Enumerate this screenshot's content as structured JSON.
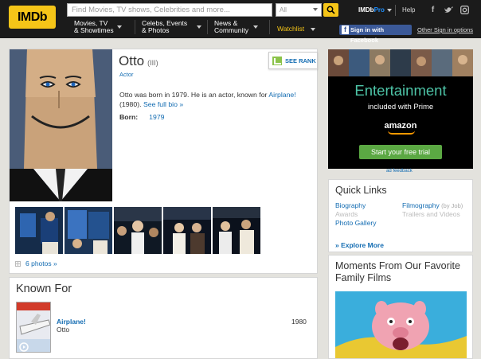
{
  "nav": {
    "logo": "IMDb",
    "search_placeholder": "Find Movies, TV shows, Celebrities and more...",
    "search_category": "All",
    "imdbpro": "IMDbPro",
    "help": "Help",
    "menu": [
      {
        "line1": "Movies, TV",
        "line2": "& Showtimes"
      },
      {
        "line1": "Celebs, Events",
        "line2": "& Photos"
      },
      {
        "line1": "News &",
        "line2": "Community"
      }
    ],
    "watchlist": "Watchlist",
    "facebook_signin": "Sign in with Facebook",
    "other_signin": "Other Sign in options",
    "social": [
      "f",
      "t",
      "o"
    ]
  },
  "profile": {
    "name": "Otto",
    "roman": "(III)",
    "role": "Actor",
    "see_rank": "SEE RANK",
    "bio_text": "Otto was born in 1979. He is an actor, known for ",
    "bio_movie": "Airplane!",
    "bio_year": " (1980). ",
    "bio_link": "See full bio »",
    "born_label": "Born:",
    "born_year": "1979",
    "photos_link": "6 photos »"
  },
  "known_for": {
    "title": "Known For",
    "movie": "Airplane!",
    "character": "Otto",
    "year": "1980"
  },
  "ad": {
    "headline": "Entertainment",
    "sub": "included with Prime",
    "brand": "amazon",
    "cta": "Start your free trial",
    "feedback": "ad feedback"
  },
  "quick_links": {
    "title": "Quick Links",
    "biography": "Biography",
    "filmography": "Filmography",
    "by_job": "(by Job)",
    "awards": "Awards",
    "trailers": "Trailers and Videos",
    "photo_gallery": "Photo Gallery",
    "explore_more": "» Explore More"
  },
  "moments": {
    "title": "Moments From Our Favorite Family Films"
  }
}
